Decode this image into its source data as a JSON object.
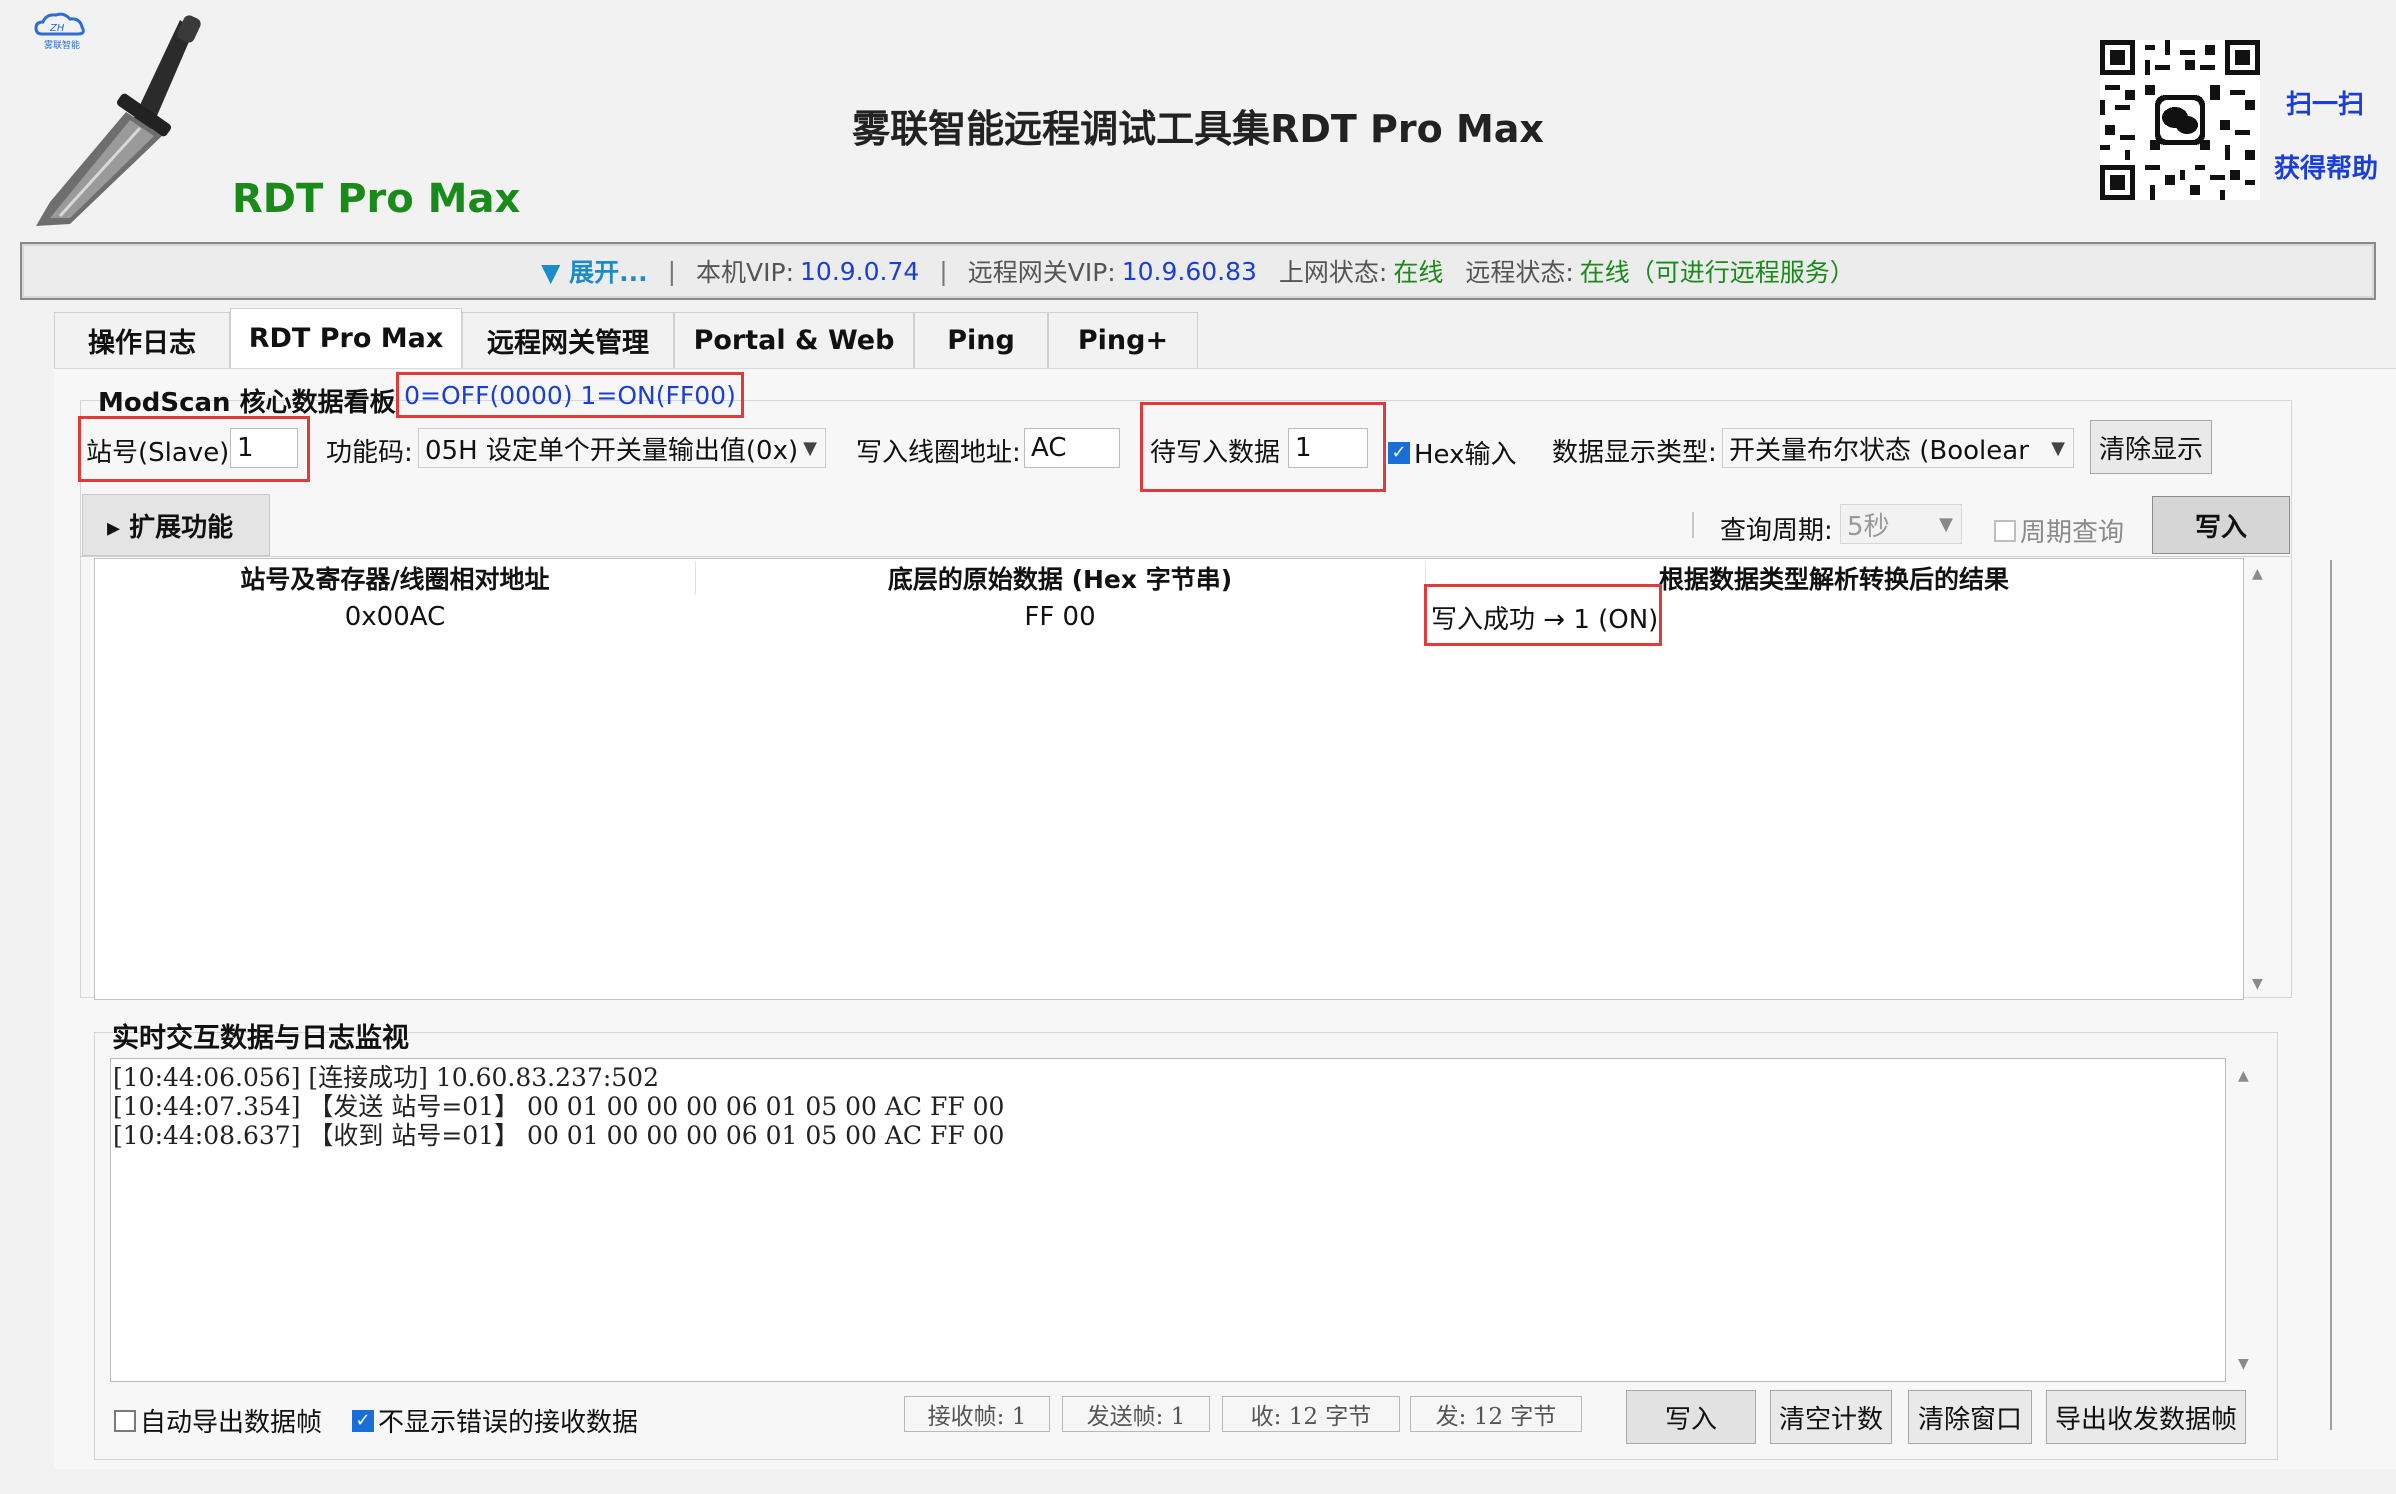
{
  "header": {
    "app_title": "雾联智能远程调试工具集RDT Pro Max",
    "brand_name": "RDT Pro Max",
    "logo_text": "雾联智能",
    "scan_label": "扫一扫",
    "help_label": "获得帮助"
  },
  "status_bar": {
    "expand_label": "▼ 展开...",
    "local_vip_label": "本机VIP:",
    "local_vip": "10.9.0.74",
    "remote_gateway_label": "远程网关VIP:",
    "remote_gateway_vip": "10.9.60.83",
    "online_label": "上网状态:",
    "online_status": "在线",
    "remote_status_label": "远程状态:",
    "remote_status": "在线（可进行远程服务）"
  },
  "tabs": [
    {
      "label": "操作日志",
      "active": false
    },
    {
      "label": "RDT Pro Max",
      "active": true
    },
    {
      "label": "远程网关管理",
      "active": false
    },
    {
      "label": "Portal & Web",
      "active": false
    },
    {
      "label": "Ping",
      "active": false
    },
    {
      "label": "Ping+",
      "active": false
    }
  ],
  "modscan": {
    "title": "ModScan 核心数据看板",
    "legend": "0=OFF(0000)  1=ON(FF00)",
    "slave_label": "站号(Slave):",
    "slave_value": "1",
    "function_label": "功能码:",
    "function_value": "05H 设定单个开关量输出值(0x)",
    "coil_addr_label": "写入线圈地址:",
    "coil_addr_value": "AC",
    "write_data_label": "待写入数据",
    "write_data_value": "1",
    "hex_input_label": "Hex输入",
    "hex_input_checked": true,
    "display_type_label": "数据显示类型:",
    "display_type_value": "开关量布尔状态 (Boolean I",
    "clear_display_label": "清除显示",
    "ext_label": "▸ 扩展功能",
    "query_period_label": "查询周期:",
    "query_period_value": "5秒",
    "periodic_query_label": "周期查询",
    "periodic_query_checked": false,
    "write_button_label": "写入"
  },
  "table": {
    "columns": [
      "站号及寄存器/线圈相对地址",
      "底层的原始数据 (Hex 字节串)",
      "根据数据类型解析转换后的结果"
    ],
    "rows": [
      [
        "0x00AC",
        "FF 00",
        "写入成功 → 1 (ON)"
      ]
    ]
  },
  "log": {
    "title": "实时交互数据与日志监视",
    "lines": [
      "[10:44:06.056] [连接成功] 10.60.83.237:502",
      "[10:44:07.354] 【发送 站号=01】 00 01 00 00 00 06 01 05 00 AC FF 00",
      "[10:44:08.637] 【收到 站号=01】 00 01 00 00 00 06 01 05 00 AC FF 00"
    ],
    "auto_export_label": "自动导出数据帧",
    "auto_export_checked": false,
    "hide_errors_label": "不显示错误的接收数据",
    "hide_errors_checked": true,
    "recv_frames": "接收帧: 1",
    "send_frames": "发送帧: 1",
    "recv_bytes": "收: 12 字节",
    "send_bytes": "发: 12 字节",
    "write_label": "写入",
    "clear_count_label": "清空计数",
    "clear_window_label": "清除窗口",
    "export_frames_label": "导出收发数据帧"
  },
  "colors": {
    "brand_green": "#1a8a1a",
    "link_blue": "#1a3fd6",
    "highlight_red": "#e03a3a"
  }
}
